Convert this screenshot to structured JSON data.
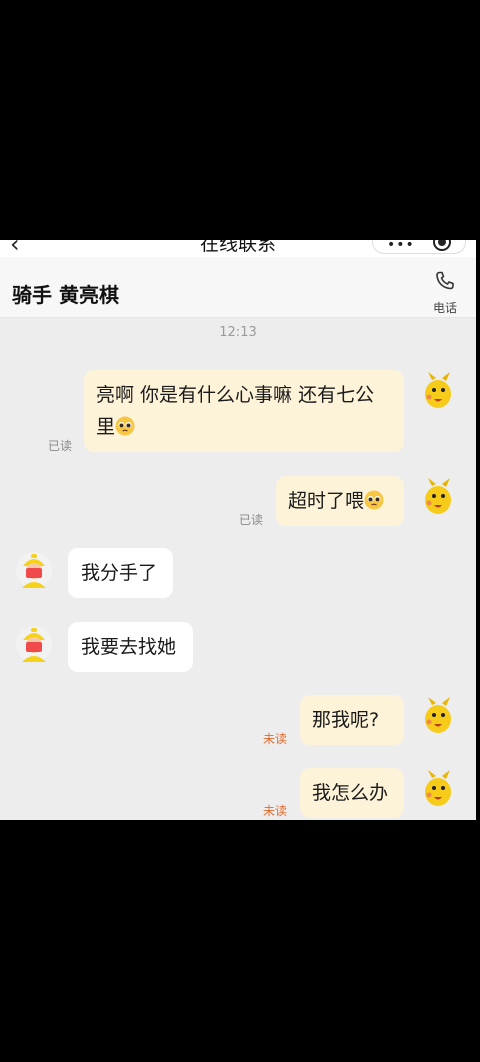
{
  "topbar": {
    "back_icon": "‹",
    "title": "在线联系",
    "more_icon": "•••"
  },
  "header": {
    "rider_name": "骑手 黄亮棋",
    "phone_label": "电话"
  },
  "timestamp": "12:13",
  "messages": [
    {
      "line1": "亮啊 你是有什么心事嘛 还有七公",
      "line2": "里",
      "status": "已读"
    },
    {
      "text": "超时了喂",
      "status": "已读"
    },
    {
      "text": "我分手了"
    },
    {
      "text": "我要去找她"
    },
    {
      "text": "那我呢?",
      "status": "未读"
    },
    {
      "text": "我怎么办",
      "status": "未读"
    }
  ],
  "colors": {
    "outgoing_bubble": "#fdf3d9",
    "incoming_bubble": "#ffffff",
    "unread": "#e06a2c",
    "read": "#8a8a8a",
    "background": "#ededed"
  }
}
